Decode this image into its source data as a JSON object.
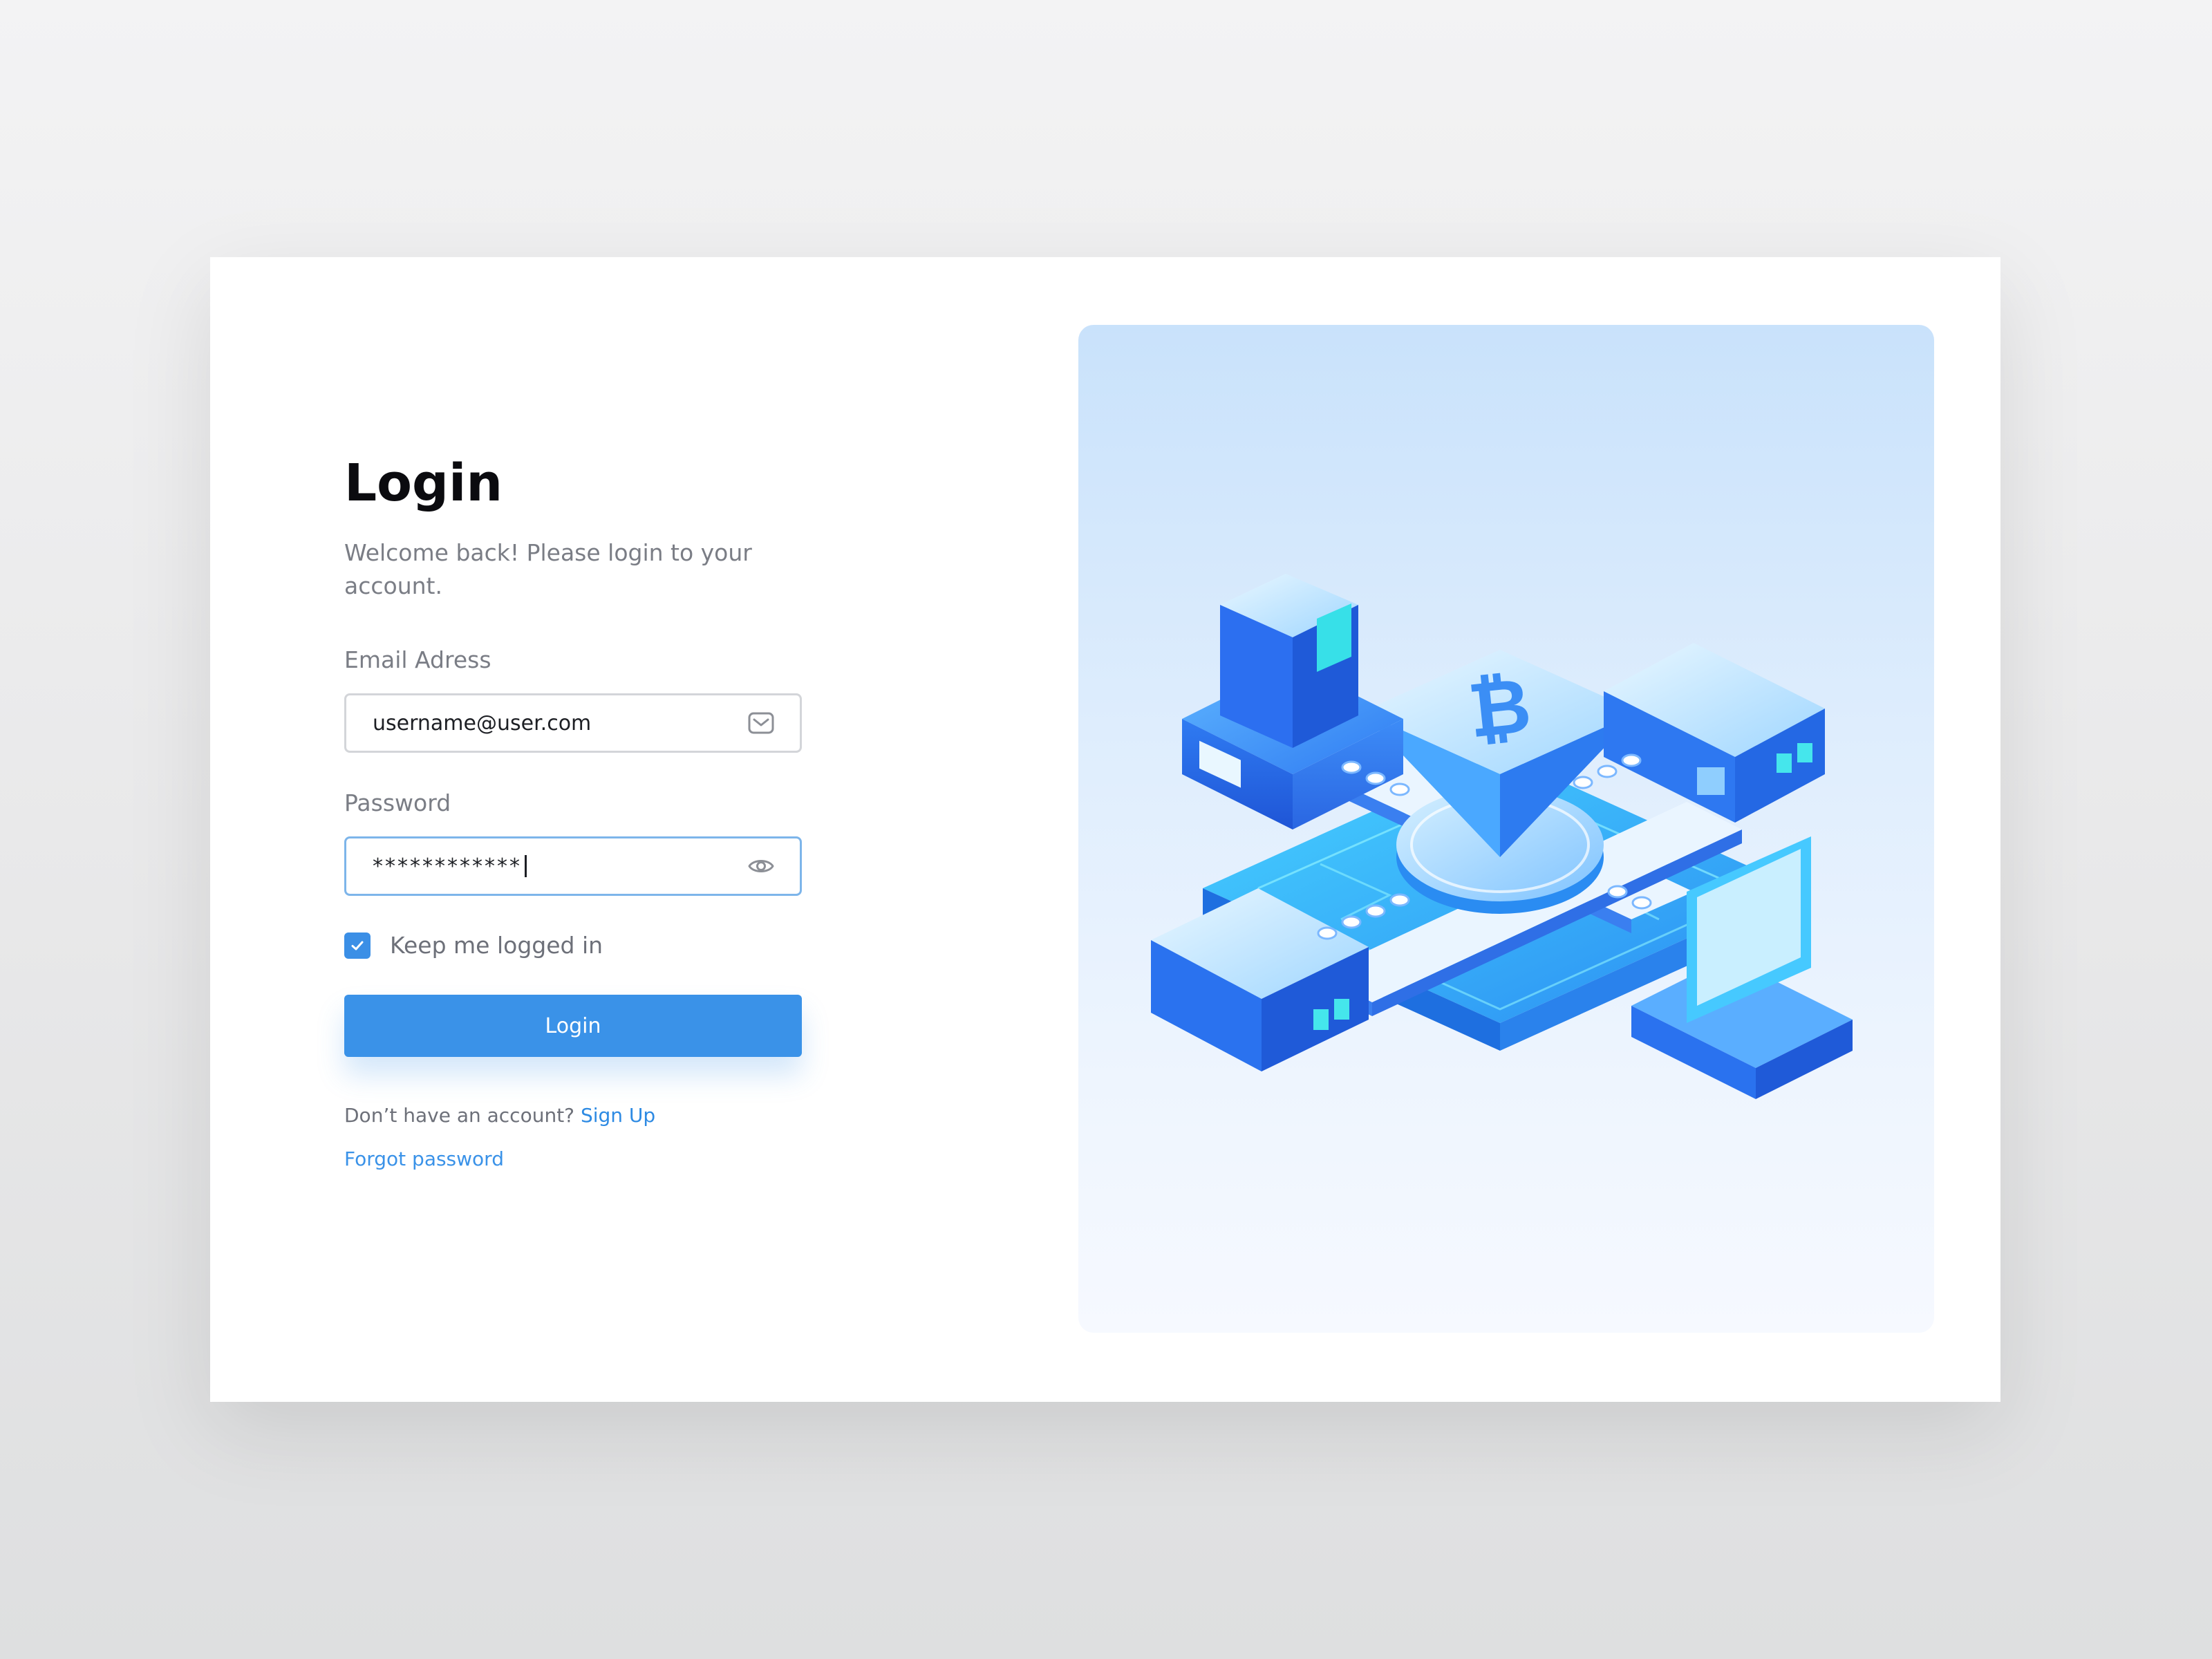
{
  "login": {
    "title": "Login",
    "subtitle": "Welcome back! Please login to your account.",
    "email_label": "Email Adress",
    "email_value": "username@user.com",
    "password_label": "Password",
    "password_value": "************",
    "remember_label": "Keep me logged in",
    "remember_checked": true,
    "button_label": "Login",
    "no_account_text": "Don’t have an account?",
    "signup_link": "Sign Up",
    "forgot_link": "Forgot password"
  },
  "icons": {
    "email_field": "mail-icon",
    "password_field": "eye-icon",
    "checkbox": "check-icon"
  },
  "colors": {
    "accent": "#3a92e8",
    "link": "#2d8ae3",
    "title": "#0b0b0f",
    "muted_text": "#7a7d85"
  }
}
